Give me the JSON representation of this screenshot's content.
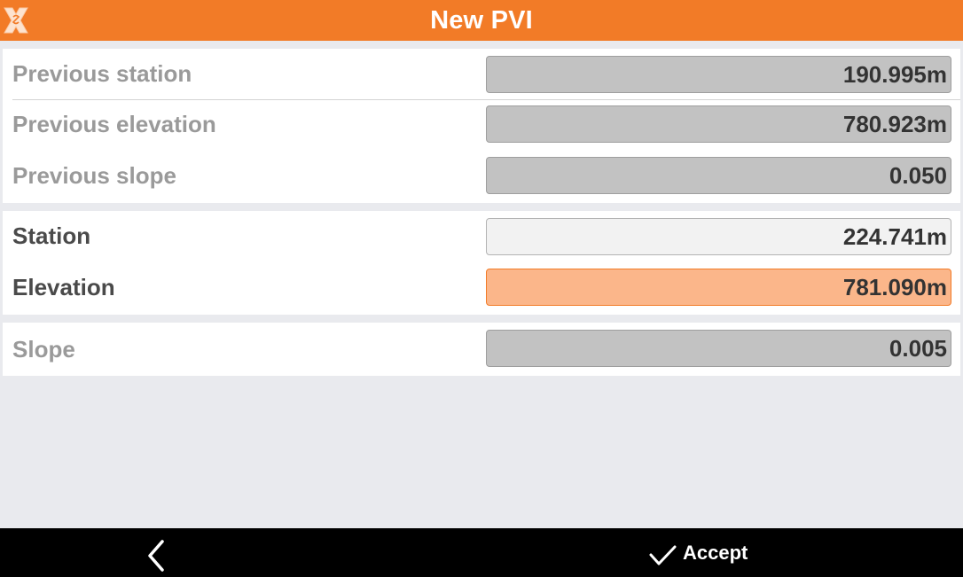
{
  "header": {
    "title": "New PVI",
    "close_icon": "close-x-icon",
    "accent_color": "#f27b27"
  },
  "previous": {
    "station": {
      "label": "Previous station",
      "value": "190.995m"
    },
    "elevation": {
      "label": "Previous elevation",
      "value": "780.923m"
    },
    "slope": {
      "label": "Previous slope",
      "value": "0.050"
    }
  },
  "current": {
    "station": {
      "label": "Station",
      "value": "224.741m"
    },
    "elevation": {
      "label": "Elevation",
      "value": "781.090m"
    }
  },
  "result": {
    "slope": {
      "label": "Slope",
      "value": "0.005"
    }
  },
  "footer": {
    "back_icon": "chevron-left-icon",
    "accept_icon": "checkmark-icon",
    "accept_label": "Accept"
  }
}
